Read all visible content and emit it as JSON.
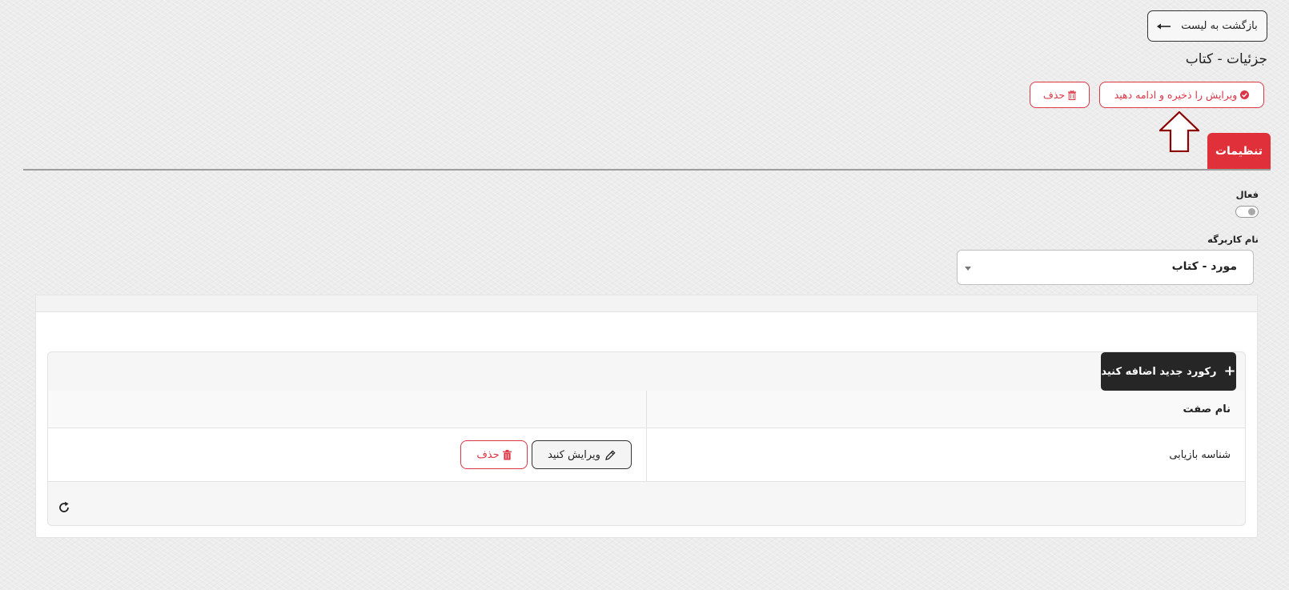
{
  "header": {
    "back_label": "بازگشت به لیست",
    "title": "جزئیات - کتاب",
    "save_label": "ویرایش را ذخیره و ادامه دهید",
    "delete_label": "حذف"
  },
  "tabs": [
    {
      "label": "تنظیمات",
      "active": true
    }
  ],
  "form": {
    "active_label": "فعال",
    "active_value": false,
    "workshop_label": "نام کاربرگه",
    "workshop_value": "مورد - کتاب"
  },
  "attributes": {
    "add_label": "رکورد جدید اضافه کنید",
    "columns": [
      "نام صفت",
      ""
    ],
    "rows": [
      {
        "name": "شناسه بازیابی",
        "edit_label": "ویرایش کنید",
        "delete_label": "حذف"
      }
    ]
  },
  "colors": {
    "accent": "#e0313b",
    "dark_button": "#262626",
    "annotation_arrow": "#8b0000"
  },
  "icons": {
    "back": "arrow-left-icon",
    "save": "check-circle-icon",
    "delete": "trash-icon",
    "add": "plus-icon",
    "edit": "pencil-icon",
    "refresh": "refresh-icon",
    "annotation": "arrow-up-annotation"
  }
}
